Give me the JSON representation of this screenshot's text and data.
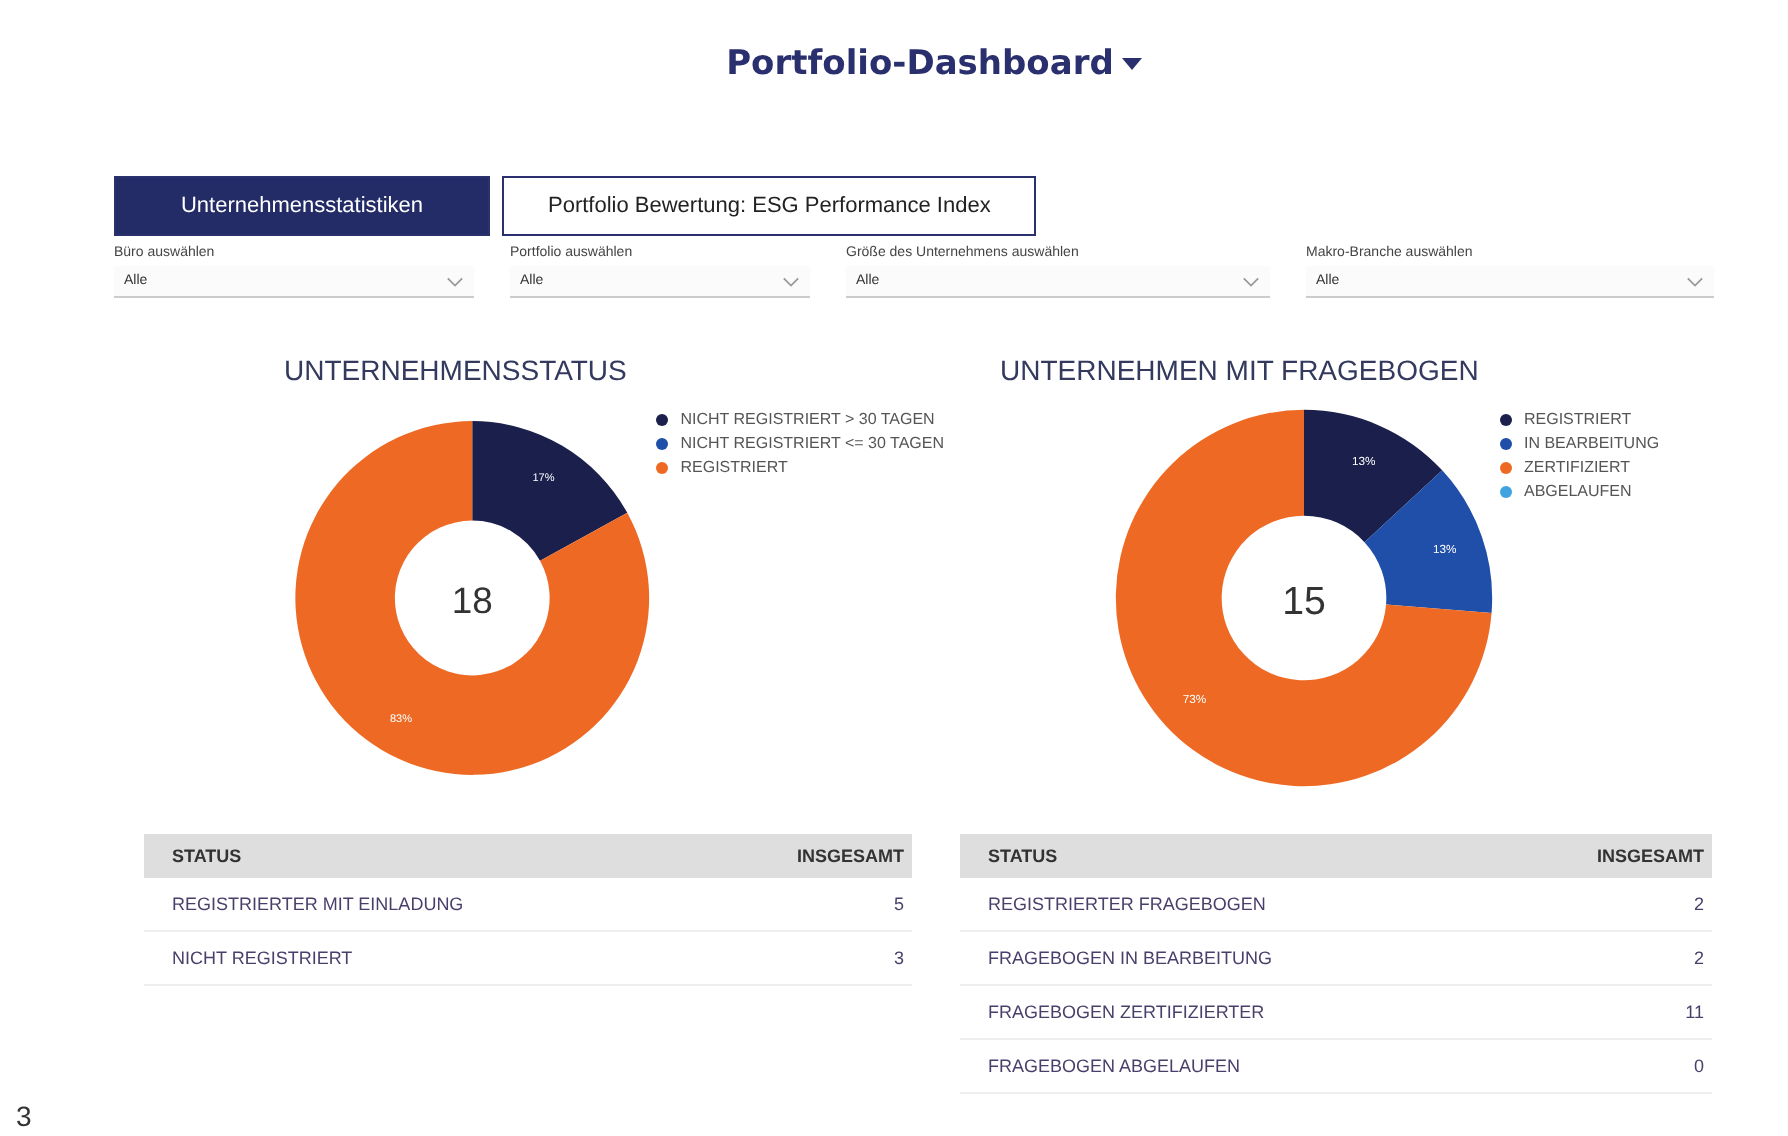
{
  "header": {
    "title": "Portfolio-Dashboard"
  },
  "tabs": [
    {
      "label": "Unternehmensstatistiken",
      "selected": true
    },
    {
      "label": "Portfolio Bewertung: ESG Performance Index",
      "selected": false
    }
  ],
  "filters": [
    {
      "label": "Büro auswählen",
      "value": "Alle"
    },
    {
      "label": "Portfolio auswählen",
      "value": "Alle"
    },
    {
      "label": "Größe des Unternehmens auswählen",
      "value": "Alle"
    },
    {
      "label": "Makro-Branche auswählen",
      "value": "Alle"
    }
  ],
  "panels": [
    {
      "center_value": "18",
      "chart_data": {
        "type": "donut",
        "title": "UNTERNEHMENSSTATUS",
        "categories": [
          "NICHT REGISTRIERT > 30 TAGEN",
          "NICHT REGISTRIERT <= 30 TAGEN",
          "REGISTRIERT"
        ],
        "series": [
          {
            "colors": [
              "#1b1f4b",
              "#1f4fa8",
              "#ee6a24"
            ],
            "values": [
              17,
              0,
              83
            ]
          }
        ],
        "value_labels": [
          "17%",
          null,
          "83%"
        ],
        "legend": "right"
      },
      "table": {
        "columns": [
          "STATUS",
          "INSGESAMT"
        ],
        "rows": [
          [
            "REGISTRIERTER MIT EINLADUNG",
            "5"
          ],
          [
            "NICHT REGISTRIERT",
            "3"
          ]
        ]
      }
    },
    {
      "center_value": "15",
      "chart_data": {
        "type": "donut",
        "title": "UNTERNEHMEN MIT FRAGEBOGEN",
        "categories": [
          "REGISTRIERT",
          "IN BEARBEITUNG",
          "ZERTIFIZIERT",
          "ABGELAUFEN"
        ],
        "series": [
          {
            "colors": [
              "#1b1f4b",
              "#1f4fa8",
              "#ee6a24",
              "#3fa3e0"
            ],
            "values": [
              13,
              13,
              73,
              0
            ]
          }
        ],
        "value_labels": [
          "13%",
          "13%",
          "73%",
          null
        ],
        "legend": "right"
      },
      "table": {
        "columns": [
          "STATUS",
          "INSGESAMT"
        ],
        "rows": [
          [
            "REGISTRIERTER FRAGEBOGEN",
            "2"
          ],
          [
            "FRAGEBOGEN IN BEARBEITUNG",
            "2"
          ],
          [
            "FRAGEBOGEN ZERTIFIZIERTER",
            "11"
          ],
          [
            "FRAGEBOGEN ABGELAUFEN",
            "0"
          ]
        ]
      }
    }
  ],
  "page_number": "3"
}
